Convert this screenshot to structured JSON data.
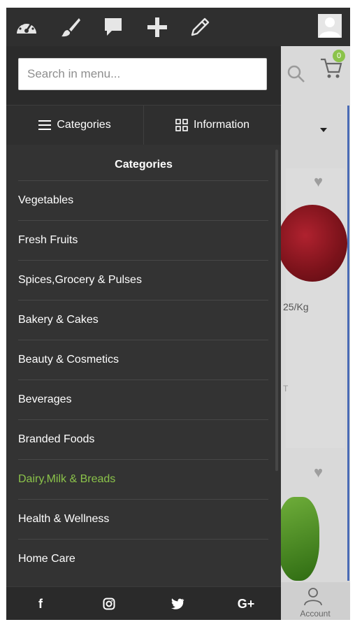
{
  "topbar": {
    "icons": [
      "dashboard-icon",
      "brush-icon",
      "comment-icon",
      "plus-icon",
      "pencil-icon"
    ],
    "avatar_icon": "user-avatar-icon"
  },
  "search": {
    "placeholder": "Search in menu..."
  },
  "tabs": [
    {
      "label": "Categories",
      "icon": "menu-icon"
    },
    {
      "label": "Information",
      "icon": "grid-icon"
    }
  ],
  "categories": {
    "title": "Categories",
    "items": [
      {
        "label": "Vegetables",
        "active": false
      },
      {
        "label": "Fresh Fruits",
        "active": false
      },
      {
        "label": "Spices,Grocery & Pulses",
        "active": false
      },
      {
        "label": "Bakery & Cakes",
        "active": false
      },
      {
        "label": "Beauty & Cosmetics",
        "active": false
      },
      {
        "label": "Beverages",
        "active": false
      },
      {
        "label": "Branded Foods",
        "active": false
      },
      {
        "label": "Dairy,Milk & Breads",
        "active": true
      },
      {
        "label": "Health & Wellness",
        "active": false
      },
      {
        "label": "Home Care",
        "active": false
      }
    ]
  },
  "social": {
    "facebook": "f",
    "instagram": "instagram-icon",
    "twitter": "twitter-icon",
    "googleplus": "G+"
  },
  "background": {
    "cart_count": "0",
    "price_partial": "25/Kg",
    "partial_text": "T",
    "account_label": "Account"
  },
  "colors": {
    "accent": "#8bc34a",
    "drawer_bg": "#333333",
    "topbar_bg": "#2f2f2f"
  }
}
